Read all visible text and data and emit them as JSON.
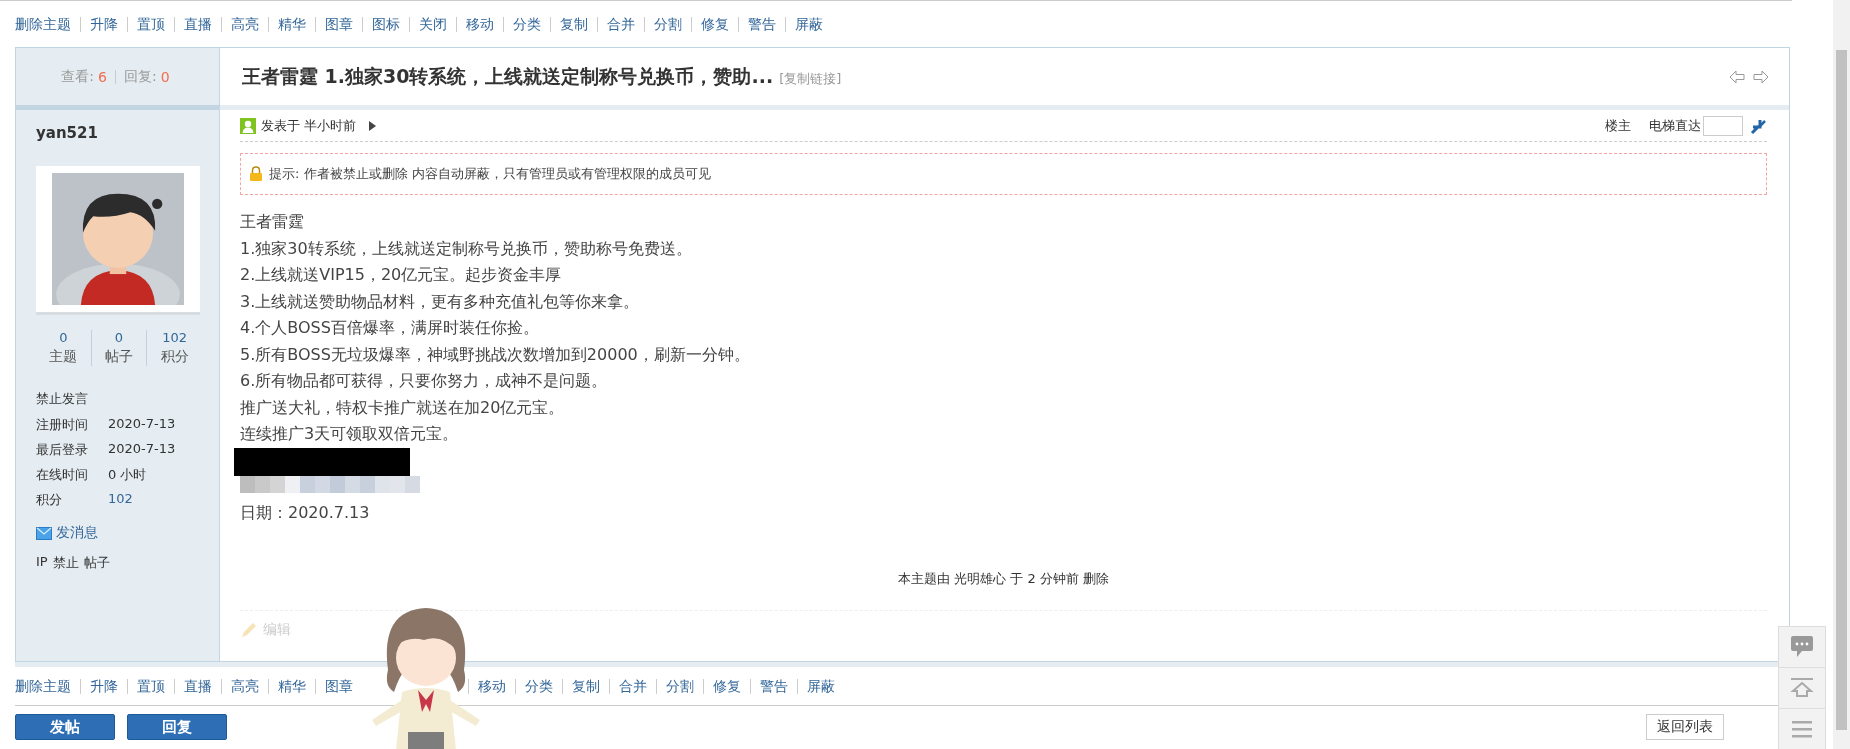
{
  "mod_bar_top": {
    "items": [
      "删除主题",
      "升降",
      "置顶",
      "直播",
      "高亮",
      "精华",
      "图章",
      "图标",
      "关闭",
      "移动",
      "分类",
      "复制",
      "合并",
      "分割",
      "修复",
      "警告",
      "屏蔽"
    ]
  },
  "post": {
    "stats": {
      "views_label": "查看:",
      "views": "6",
      "replies_label": "回复:",
      "replies": "0"
    },
    "title": "王者雷霆 1.独家30转系统，上线就送定制称号兑换币，赞助...",
    "copy_link": "[复制链接]",
    "author": {
      "name": "yan521",
      "avatar": {
        "kind": "picture"
      },
      "counts": [
        {
          "value": "0",
          "label": "主题"
        },
        {
          "value": "0",
          "label": "帖子"
        },
        {
          "value": "102",
          "label": "积分"
        }
      ],
      "group": "禁止发言",
      "info": [
        {
          "label": "注册时间",
          "value": "2020-7-13",
          "link": false
        },
        {
          "label": "最后登录",
          "value": "2020-7-13",
          "link": false
        },
        {
          "label": "在线时间",
          "value": "0 小时",
          "link": false
        },
        {
          "label": "积分",
          "value": "102",
          "link": true
        }
      ],
      "message_link": "发消息",
      "admin_links": [
        "IP",
        "禁止",
        "帖子"
      ]
    },
    "posted": "发表于 半小时前",
    "floor": "楼主",
    "elevator": "电梯直达",
    "notice": "提示: 作者被禁止或删除 内容自动屏蔽，只有管理员或有管理权限的成员可见",
    "body": [
      "王者雷霆",
      "1.独家30转系统，上线就送定制称号兑换币，赞助称号免费送。",
      "2.上线就送VIP15，20亿元宝。起步资金丰厚",
      "3.上线就送赞助物品材料，更有多种充值礼包等你来拿。",
      "4.个人BOSS百倍爆率，满屏时装任你捡。",
      "5.所有BOSS无垃圾爆率，神域野挑战次数增加到20000，刷新一分钟。",
      "6.所有物品都可获得，只要你努力，成神不是问题。",
      "推广送大礼，特权卡推广就送在加20亿元宝。",
      "连续推广3天可领取双倍元宝。"
    ],
    "redactions": [
      {
        "kind": "black"
      },
      {
        "kind": "blur"
      }
    ],
    "date": "日期：2020.7.13",
    "moderation_note": "本主题由 光明雄心 于 2 分钟前 删除",
    "edit": {
      "label": "编辑",
      "disabled": true
    }
  },
  "mod_bar_bottom": {
    "before_overlay": [
      "删除主题",
      "升降",
      "置顶",
      "直播",
      "高亮",
      "精华",
      "图章"
    ],
    "after_overlay": [
      "移动",
      "分类",
      "复制",
      "合并",
      "分割",
      "修复",
      "警告",
      "屏蔽"
    ]
  },
  "overlay": {
    "kind": "picture"
  },
  "buttons": [
    "发帖",
    "回复"
  ],
  "back_link": "返回列表"
}
